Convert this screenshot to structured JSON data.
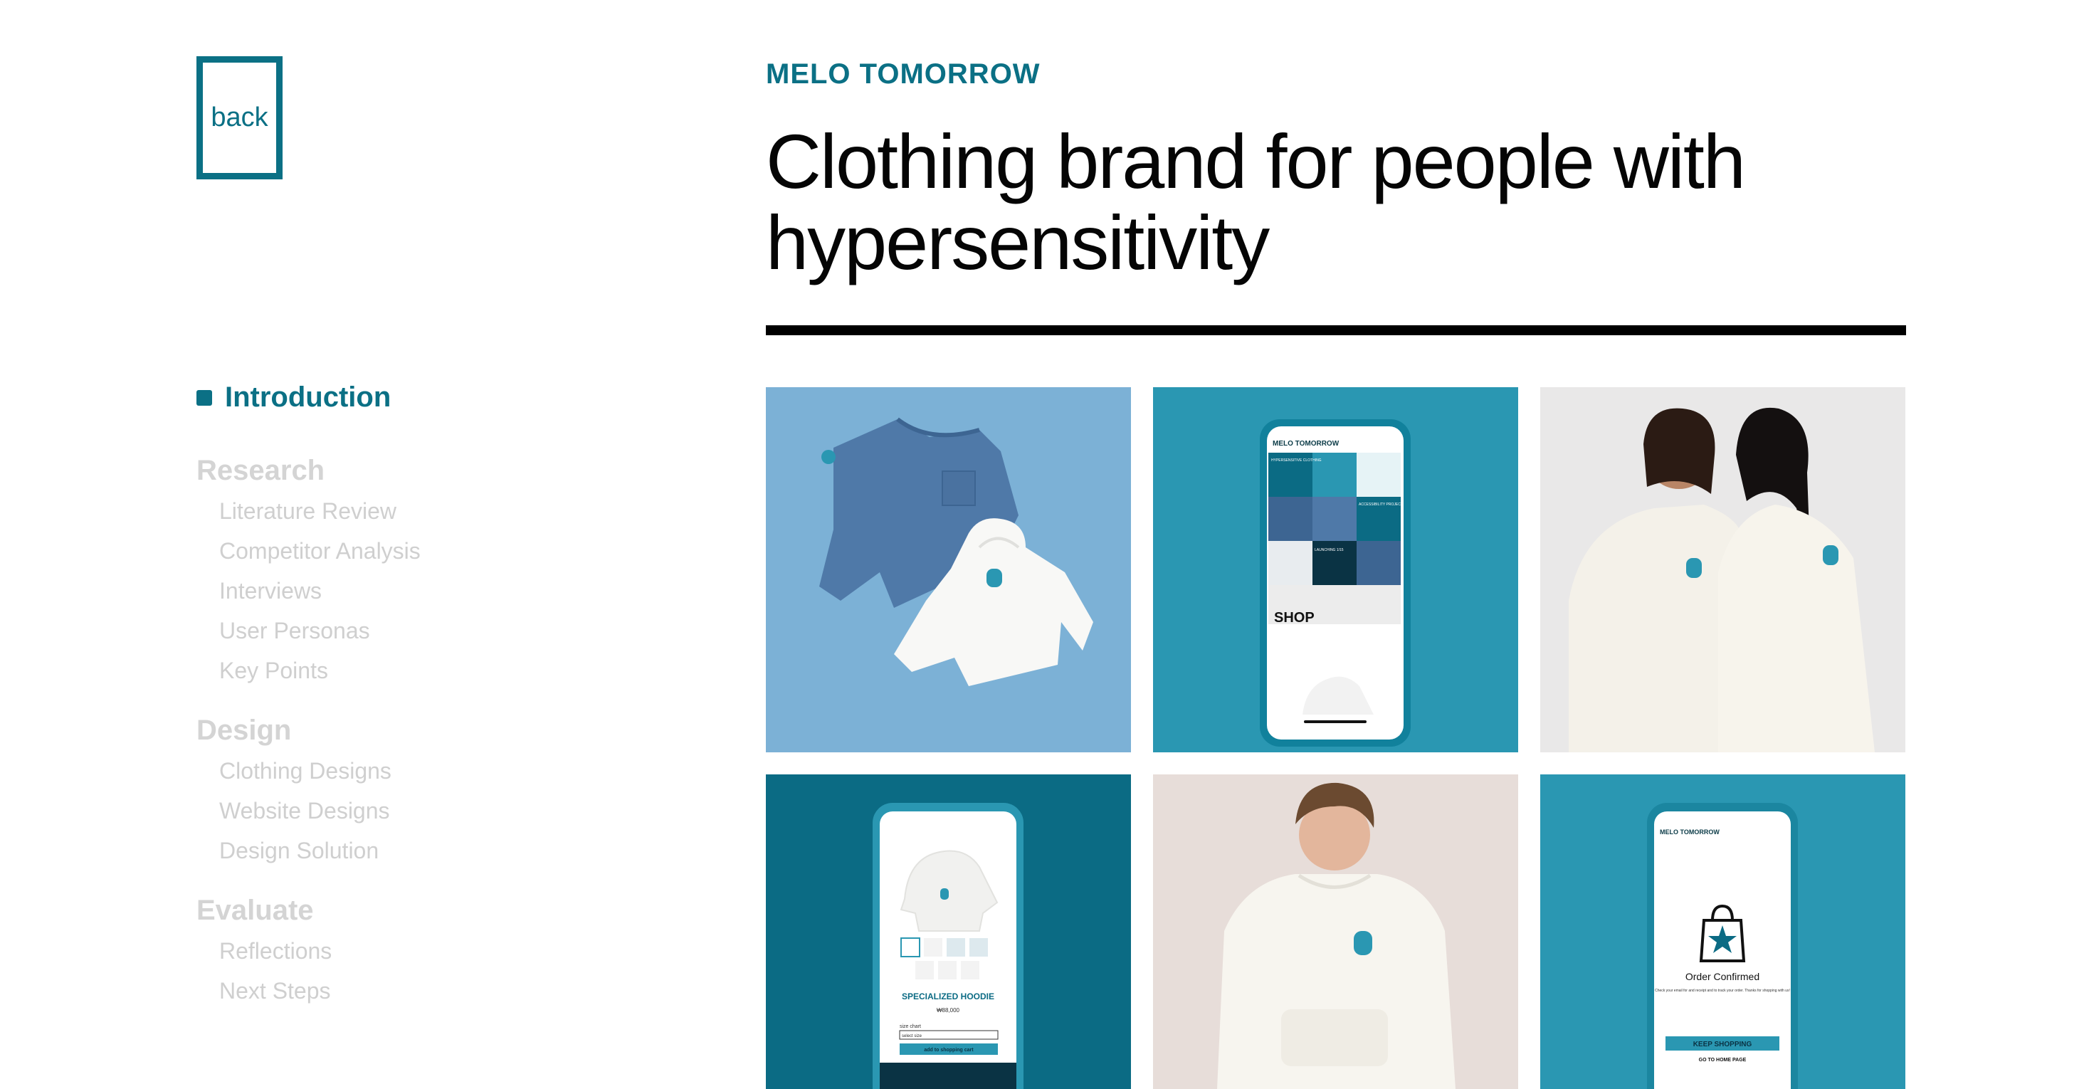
{
  "back_button": {
    "label": "back"
  },
  "header": {
    "eyebrow": "MELO TOMORROW",
    "title": "Clothing brand for people with hypersensitivity"
  },
  "nav": {
    "active": "Introduction",
    "sections": [
      {
        "title": "Research",
        "items": [
          "Literature Review",
          "Competitor Analysis",
          "Interviews",
          "User Personas",
          "Key Points"
        ]
      },
      {
        "title": "Design",
        "items": [
          "Clothing Designs",
          "Website Designs",
          "Design Solution"
        ]
      },
      {
        "title": "Evaluate",
        "items": [
          "Reflections",
          "Next Steps"
        ]
      }
    ]
  },
  "gallery": {
    "phone_home": {
      "brand": "MELO TOMORROW",
      "tile_label_1": "HYPERSENSITIVE CLOTHING",
      "tile_label_2": "ACCESSIBILITY PROJECT",
      "tile_label_3": "LAUNCHING 1/15",
      "shop_label": "SHOP"
    },
    "phone_product": {
      "product_name": "SPECIALIZED HOODIE",
      "price": "₩88,000",
      "size_label": "size chart",
      "size_select": "select size",
      "add_to_cart": "add to shopping cart"
    },
    "phone_order": {
      "brand": "MELO TOMORROW",
      "confirm_title": "Order Confirmed",
      "confirm_text": "Check your email for and receipt and to track your order. Thanks for shopping with us!",
      "keep_shopping": "KEEP SHOPPING",
      "home_link": "GO TO HOME PAGE"
    }
  },
  "colors": {
    "accent": "#0b7085",
    "teal": "#2a97b2",
    "dark_teal": "#0b6b84",
    "light_blue": "#7cb1d6",
    "muted_nav": "#cfcfcf"
  }
}
